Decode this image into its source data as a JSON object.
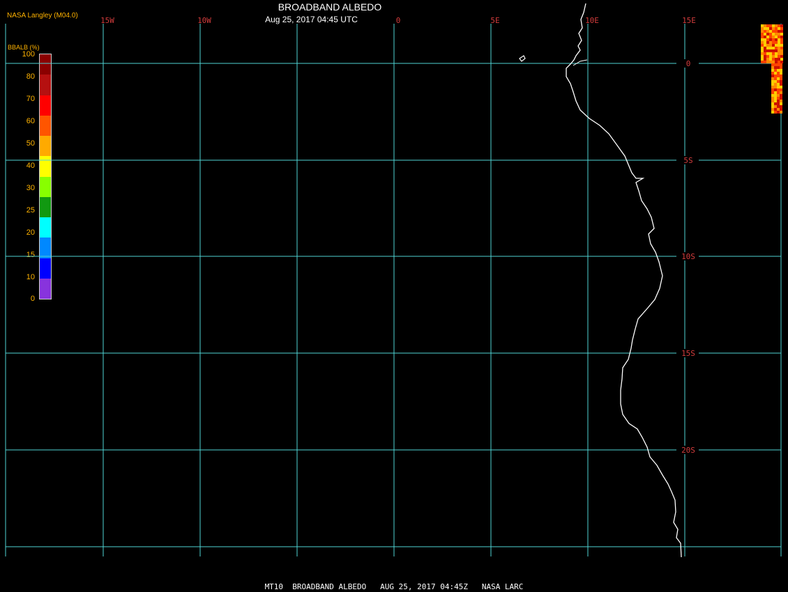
{
  "header": {
    "provider": "NASA Langley (M04.0)",
    "title": "BROADBAND ALBEDO",
    "subtitle": "Aug 25, 2017 04:45 UTC"
  },
  "footer": {
    "caption": "MT10  BROADBAND ALBEDO   AUG 25, 2017 04:45Z   NASA LARC"
  },
  "colorbar": {
    "title": "BBALB (%)",
    "ticks": [
      "100",
      "80",
      "70",
      "60",
      "50",
      "40",
      "30",
      "25",
      "20",
      "15",
      "10",
      "0"
    ],
    "colors": [
      "#8b0000",
      "#b51010",
      "#ff0000",
      "#ff5500",
      "#ffaa00",
      "#ffff00",
      "#88ff00",
      "#119911",
      "#00ffff",
      "#0088ff",
      "#0000ff",
      "#8833dd"
    ]
  },
  "map": {
    "grid_color": "#4fd4d4",
    "coast_color": "#ffffff",
    "longitude_labels": [
      "15W",
      "10W",
      "0",
      "5E",
      "10E",
      "15E"
    ],
    "latitude_labels": [
      "0",
      "5S",
      "10S",
      "15S",
      "20S"
    ],
    "cloud_colors": [
      "#ff4400",
      "#ffcc00",
      "#ff8800",
      "#cc1100"
    ]
  }
}
